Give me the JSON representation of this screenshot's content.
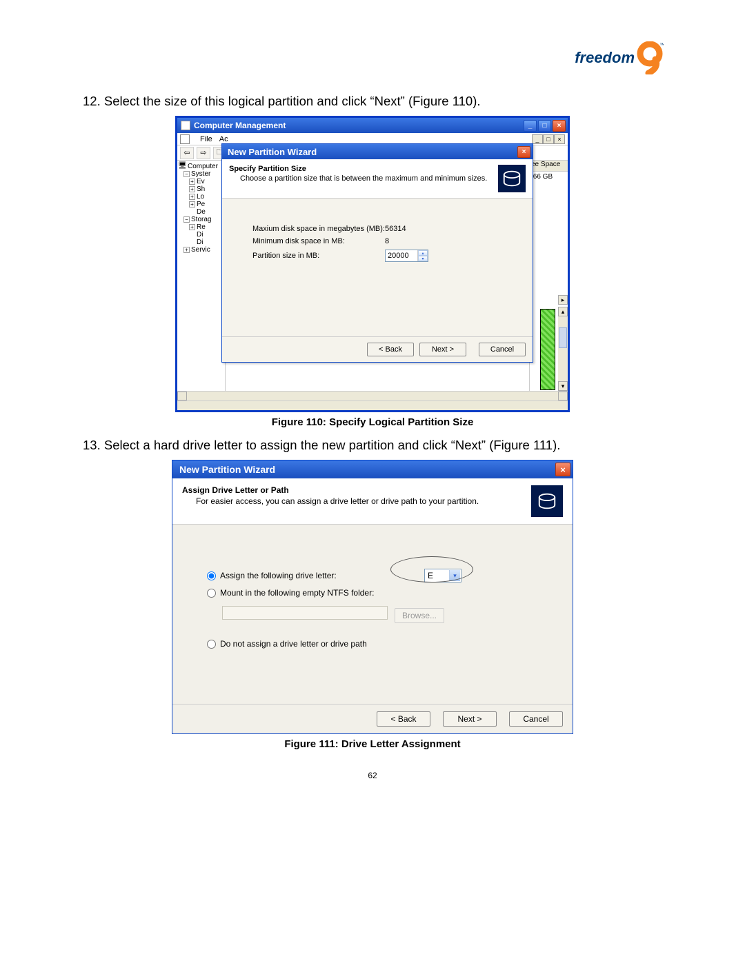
{
  "logo": {
    "text": "freedom"
  },
  "step12": "12. Select the size of this logical partition and click “Next” (Figure 110).",
  "step13": "13. Select a hard drive letter to assign the new partition and click “Next” (Figure 111).",
  "caption110": "Figure 110: Specify Logical Partition Size",
  "caption111": "Figure 111: Drive Letter Assignment",
  "pagenum": "62",
  "cm": {
    "title": "Computer Management",
    "menu_file": "File",
    "menu_act": "Ac",
    "mdi_min": "_",
    "mdi_max": "□",
    "mdi_close": "×",
    "tree_root": "Computer",
    "tree_system": "Syster",
    "tree_ev": "Ev",
    "tree_sh": "Sh",
    "tree_lo": "Lo",
    "tree_pe": "Pe",
    "tree_de": "De",
    "tree_storage": "Storag",
    "tree_re": "Re",
    "tree_di1": "Di",
    "tree_di2": "Di",
    "tree_services": "Servic",
    "col_space": "ee Space",
    "col_val": ".66 GB"
  },
  "wiz1": {
    "title": "New Partition Wizard",
    "head_title": "Specify Partition Size",
    "head_sub": "Choose a partition size that is between the maximum and minimum sizes.",
    "max_lbl": "Maxium disk space in megabytes (MB):",
    "max_val": "56314",
    "min_lbl": "Minimum disk space in MB:",
    "min_val": "8",
    "psize_lbl": "Partition size in MB:",
    "psize_val": "20000",
    "back": "< Back",
    "next": "Next >",
    "cancel": "Cancel"
  },
  "wiz2": {
    "title": "New Partition Wizard",
    "head_title": "Assign Drive Letter or Path",
    "head_sub": "For easier access, you can assign a drive letter or drive path to your partition.",
    "opt_assign": "Assign the following drive letter:",
    "drive_letter": "E",
    "opt_mount": "Mount in the following empty NTFS folder:",
    "browse": "Browse...",
    "opt_none": "Do not assign a drive letter or drive path",
    "back": "< Back",
    "next": "Next >",
    "cancel": "Cancel"
  }
}
